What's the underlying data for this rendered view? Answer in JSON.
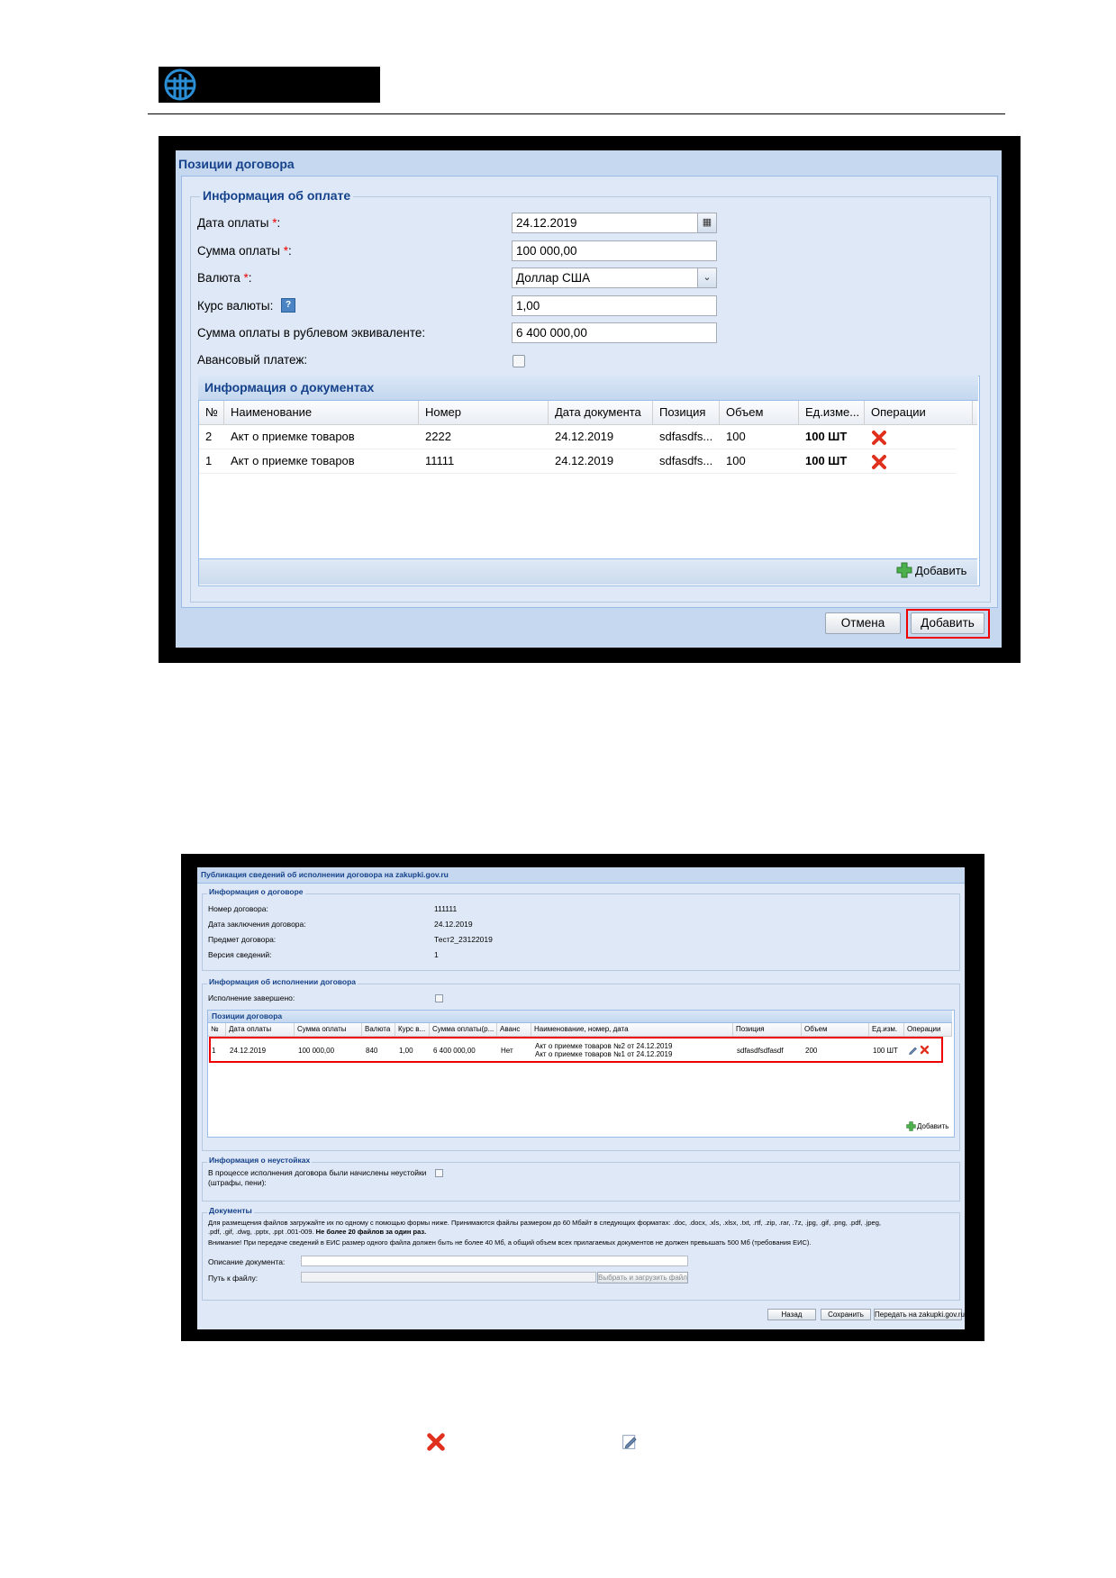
{
  "dialog1": {
    "title": "Позиции договора",
    "section_title": "Информация об оплате",
    "fields": {
      "date_label": "Дата оплаты ",
      "date_value": "24.12.2019",
      "sum_label": "Сумма оплаты ",
      "sum_value": "100 000,00",
      "currency_label": "Валюта ",
      "currency_value": "Доллар США",
      "rate_label": "Курс валюты: ",
      "rate_value": "1,00",
      "rub_label": "Сумма оплаты в рублевом эквиваленте:",
      "rub_value": "6 400 000,00",
      "advance_label": "Авансовый платеж:",
      "required_mark": "*",
      "colon": ":",
      "help_mark": "?"
    },
    "docs": {
      "title": "Информация о документах",
      "columns": [
        "№",
        "Наименование",
        "Номер",
        "Дата документа",
        "Позиция",
        "Объем",
        "Ед.изме...",
        "Операции"
      ],
      "rows": [
        {
          "n": "2",
          "name": "Акт о приемке товаров",
          "number": "2222",
          "date": "24.12.2019",
          "position": "sdfasdfs...",
          "volume": "100",
          "unit": "100 ШТ"
        },
        {
          "n": "1",
          "name": "Акт о приемке товаров",
          "number": "11111",
          "date": "24.12.2019",
          "position": "sdfasdfs...",
          "volume": "100",
          "unit": "100 ШТ"
        }
      ],
      "add_label": "Добавить"
    },
    "cancel_label": "Отмена",
    "add_label": "Добавить"
  },
  "dialog2": {
    "title": "Публикация сведений об исполнении договора на zakupki.gov.ru",
    "contract_section": "Информация о договоре",
    "contract": [
      {
        "label": "Номер договора:",
        "value": "111111"
      },
      {
        "label": "Дата заключения договора:",
        "value": "24.12.2019"
      },
      {
        "label": "Предмет договора:",
        "value": "Тест2_23122019"
      },
      {
        "label": "Версия сведений:",
        "value": "1"
      }
    ],
    "execution_section": "Информация об исполнении договора",
    "execution_done_label": "Исполнение завершено:",
    "positions_title": "Позиции договора",
    "positions_columns": [
      "№",
      "Дата оплаты",
      "Сумма оплаты",
      "Валюта",
      "Курс в...",
      "Сумма оплаты(р...",
      "Аванс",
      "Наименование, номер, дата",
      "Позиция",
      "Объем",
      "Ед.изм.",
      "Операции"
    ],
    "position_row": {
      "n": "1",
      "date": "24.12.2019",
      "sum": "100 000,00",
      "currency": "840",
      "rate": "1,00",
      "rub": "6 400 000,00",
      "advance": "Нет",
      "doc_line1": "Акт о приемке товаров №2 от 24.12.2019",
      "doc_line2": "Акт о приемке товаров №1 от 24.12.2019",
      "position": "sdfasdfsdfasdf",
      "volume": "200",
      "unit": "100 ШТ"
    },
    "positions_add": "Добавить",
    "penalty_section": "Информация о неустойках",
    "penalty_label_1": "В процессе исполнения договора были начислены неустойки",
    "penalty_label_2": "(штрафы, пени):",
    "documents_section": "Документы",
    "documents_text_1": "Для размещения файлов загружайте их по одному с помощью формы ниже. Принимаются файлы размером до 60 Мбайт в следующих форматах: .doc, .docx, .xls, .xlsx, .txt, .rtf, .zip, .rar, .7z, .jpg, .gif, .png, .pdf, .jpeg,",
    "documents_text_2": ".pdf, .gif, .dwg, .pptx, .ppt .001-009. ",
    "documents_text_2_bold": "Не более 20 файлов за один раз.",
    "documents_text_3": "Внимание! При передаче сведений в ЕИС размер одного файла должен быть не более 40 Мб, а общий объем всех прилагаемых документов не должен превышать 500 Мб (требования ЕИС).",
    "doc_description_label": "Описание документа:",
    "file_path_label": "Путь к файлу:",
    "upload_button": "Выбрать и загрузить файл",
    "back_button": "Назад",
    "save_button": "Сохранить",
    "send_button": "Передать на zakupki.gov.ru"
  },
  "colors": {
    "window_bg": "#dfe8f6",
    "title_blue": "#15428b",
    "highlight_red": "#e00000"
  }
}
